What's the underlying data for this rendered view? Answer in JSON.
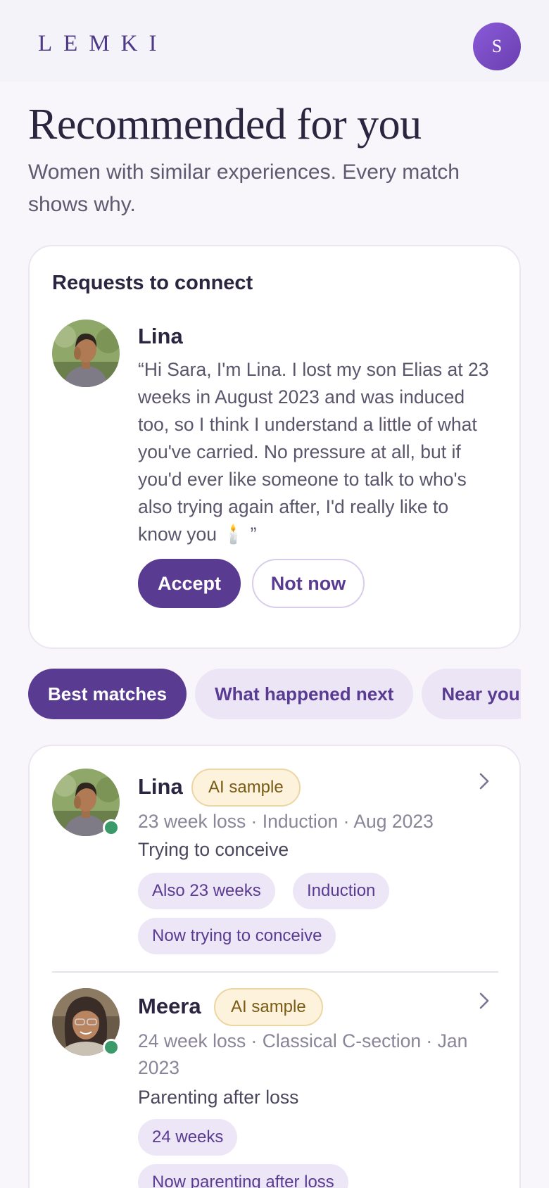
{
  "header": {
    "logo": "LEMKI",
    "avatar_initial": "S"
  },
  "page": {
    "title": "Recommended for you",
    "subtitle": "Women with similar experiences. Every match shows why."
  },
  "requests": {
    "title": "Requests to connect",
    "items": [
      {
        "name": "Lina",
        "message": "“Hi Sara, I'm Lina. I lost my son Elias at 23 weeks in August 2023 and was induced too, so I think I understand a little of what you've carried. No pressure at all, but if you'd ever like someone to talk to who's also trying again after, I'd really like to know you 🕯️ ”",
        "accept_label": "Accept",
        "decline_label": "Not now"
      }
    ]
  },
  "tabs": [
    {
      "label": "Best matches",
      "active": true
    },
    {
      "label": "What happened next",
      "active": false
    },
    {
      "label": "Near you",
      "active": false
    }
  ],
  "matches": [
    {
      "name": "Lina",
      "badge": "AI sample",
      "meta": "23 week loss · Induction · Aug 2023",
      "status": "Trying to conceive",
      "chips": [
        "Also 23 weeks",
        "Induction",
        "Now trying to conceive"
      ],
      "online": true
    },
    {
      "name": "Meera",
      "badge": "AI sample",
      "meta": "24 week loss · Classical C-section · Jan 2023",
      "status": "Parenting after loss",
      "chips": [
        "24 weeks",
        "Now parenting after loss"
      ],
      "online": true
    }
  ],
  "colors": {
    "accent": "#5a3b92",
    "chip_bg": "#ece6f7",
    "badge_bg": "#fdf3dc",
    "online": "#3a9a6a"
  },
  "icons": [
    "chevron-right-icon",
    "online-status-icon"
  ]
}
